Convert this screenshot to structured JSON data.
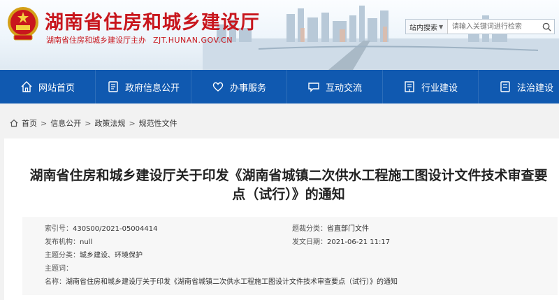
{
  "header": {
    "title": "湖南省住房和城乡建设厅",
    "subtitle": "湖南省住房和城乡建设厅主办",
    "url": "ZJT.HUNAN.GOV.CN",
    "search": {
      "scope": "站内搜索",
      "placeholder": "请输入关键词进行检索"
    }
  },
  "nav": {
    "items": [
      {
        "label": "网站首页",
        "icon": "home-icon"
      },
      {
        "label": "政府信息公开",
        "icon": "document-icon"
      },
      {
        "label": "办事服务",
        "icon": "heart-icon"
      },
      {
        "label": "互动交流",
        "icon": "chat-icon"
      },
      {
        "label": "行业建设",
        "icon": "building-icon"
      },
      {
        "label": "法治建设",
        "icon": "law-icon"
      }
    ]
  },
  "breadcrumb": [
    "首页",
    "信息公开",
    "政策法规",
    "规范性文件"
  ],
  "article": {
    "title": "湖南省住房和城乡建设厅关于印发《湖南省城镇二次供水工程施工图设计文件技术审查要点（试行）》的通知",
    "meta": {
      "index_label": "索引号：",
      "index_value": "430S00/2021-05004414",
      "category_label": "题裁分类：",
      "category_value": "省直部门文件",
      "issuer_label": "发布机构：",
      "issuer_value": "null",
      "date_label": "发文日期：",
      "date_value": "2021-06-21 11:17",
      "theme_label": "主题分类：",
      "theme_value": "城乡建设、环境保护",
      "keywords_label": "主题词：",
      "keywords_value": "",
      "name_label": "名称：",
      "name_value": "湖南省住房和城乡建设厅关于印发《湖南省城镇二次供水工程施工图设计文件技术审查要点（试行）》的通知"
    }
  },
  "colors": {
    "brand_red": "#c8161d",
    "nav_blue": "#1059b0"
  }
}
